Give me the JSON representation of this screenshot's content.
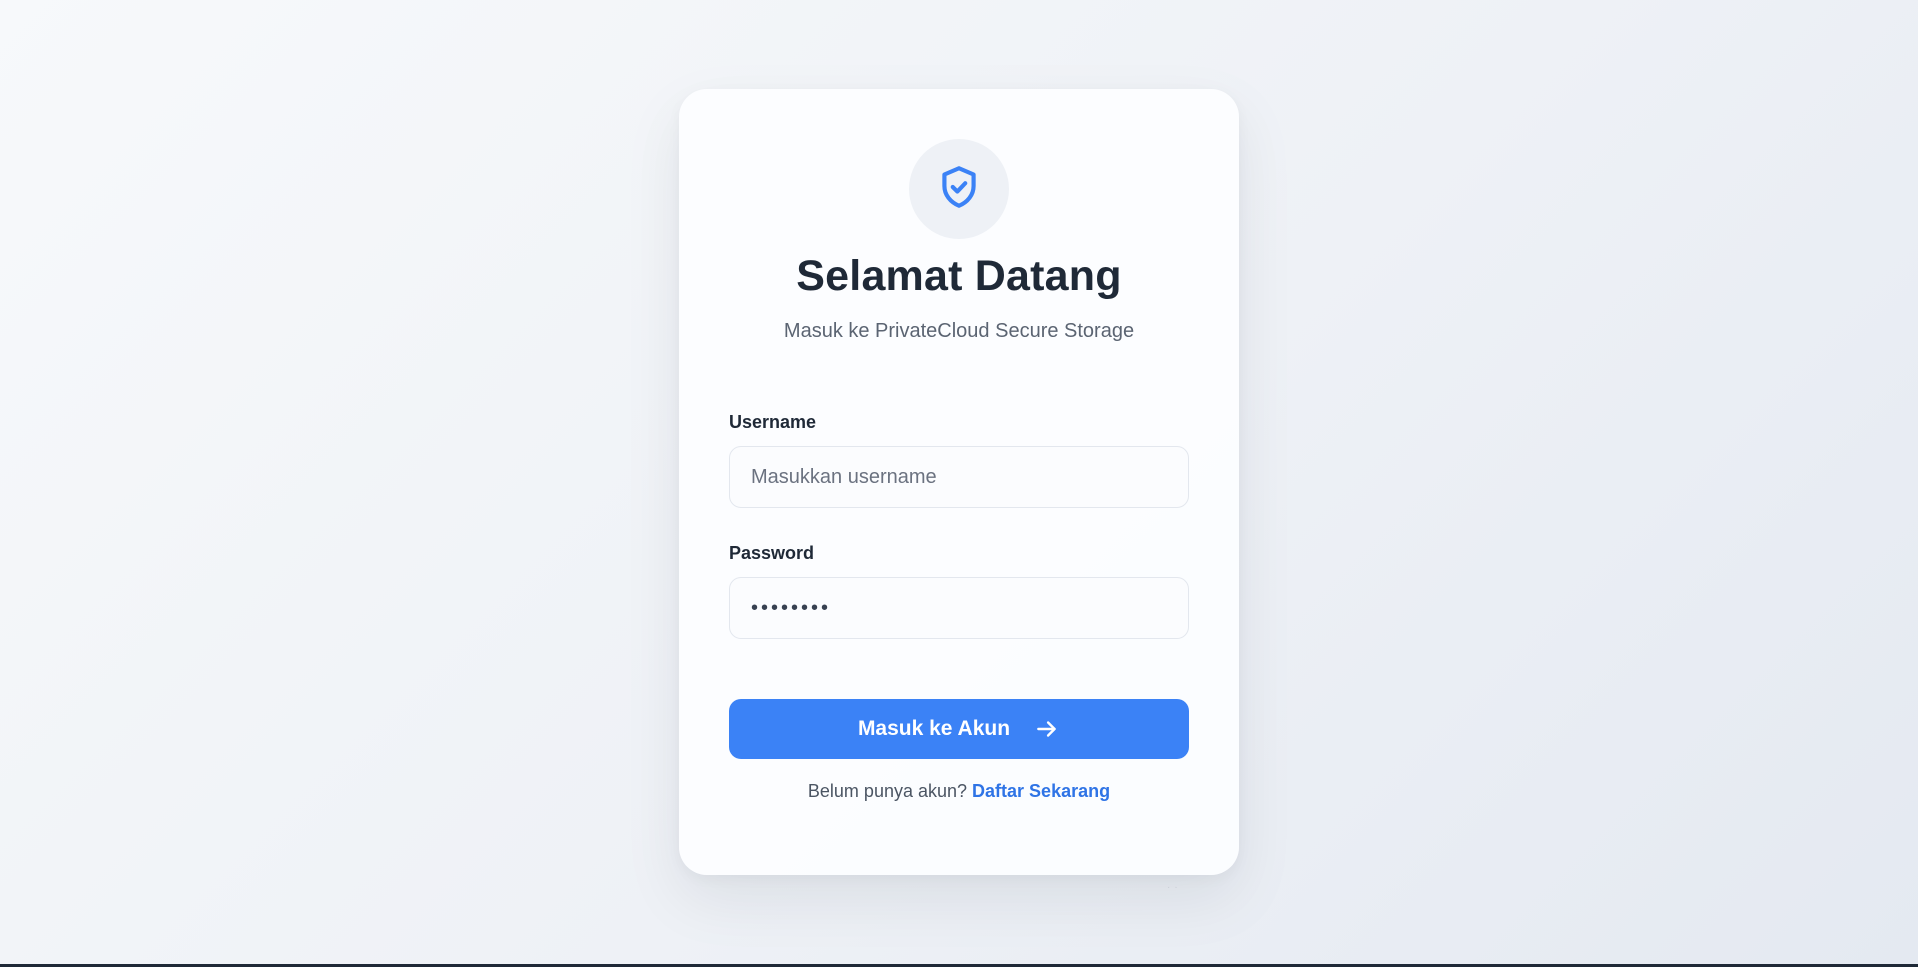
{
  "colors": {
    "accent": "#3b82f6",
    "link": "#2f74e6",
    "heading": "#1f2937",
    "muted": "#5b6472"
  },
  "header": {
    "icon": "shield-check-icon",
    "title": "Selamat Datang",
    "subtitle": "Masuk ke PrivateCloud Secure Storage"
  },
  "form": {
    "username_label": "Username",
    "username_placeholder": "Masukkan username",
    "password_label": "Password",
    "password_value": "••••••••",
    "submit_label": "Masuk ke Akun",
    "submit_icon": "arrow-right-icon"
  },
  "footer": {
    "prompt": "Belum punya akun?",
    "register_link": "Daftar Sekarang"
  }
}
